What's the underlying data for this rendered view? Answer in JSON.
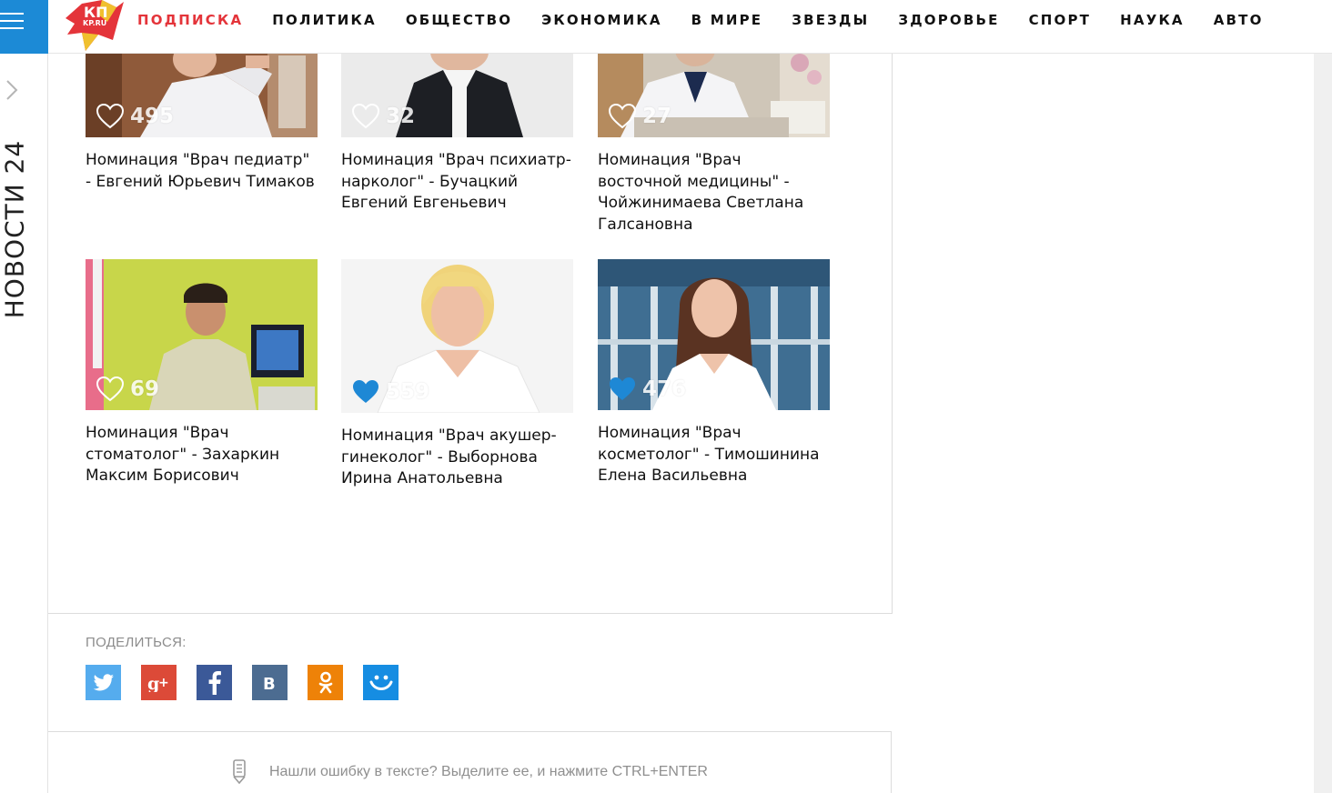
{
  "rail": {
    "title": "НОВОСТИ 24"
  },
  "logo": {
    "text_top": "КП",
    "text_bottom": "KP.RU"
  },
  "nav": {
    "items": [
      {
        "label": "ПОДПИСКА",
        "highlight": true
      },
      {
        "label": "ПОЛИТИКА"
      },
      {
        "label": "ОБЩЕСТВО"
      },
      {
        "label": "ЭКОНОМИКА"
      },
      {
        "label": "В МИРЕ"
      },
      {
        "label": "ЗВЕЗДЫ"
      },
      {
        "label": "ЗДОРОВЬЕ"
      },
      {
        "label": "СПОРТ"
      },
      {
        "label": "НАУКА"
      },
      {
        "label": "АВТО"
      }
    ]
  },
  "colors": {
    "accent_blue": "#1c8ad6",
    "nav_highlight": "#e4343a",
    "like_filled": "#1e88d5"
  },
  "nominees": [
    {
      "likes": "495",
      "liked": false,
      "caption": "Номинация \"Врач педиатр\" - Евгений Юрьевич Тимаков"
    },
    {
      "likes": "32",
      "liked": false,
      "caption": "Номинация \"Врач психиатр-нарколог\" - Бучацкий Евгений Евгеньевич"
    },
    {
      "likes": "27",
      "liked": false,
      "caption": "Номинация \"Врач восточной медицины\" - Чойжинимаева Светлана Галсановна"
    },
    {
      "likes": "69",
      "liked": false,
      "caption": "Номинация \"Врач стоматолог\" - Захаркин Максим Борисович"
    },
    {
      "likes": "559",
      "liked": true,
      "caption": "Номинация \"Врач акушер-гинеколог\" - Выборнова Ирина Анатольевна"
    },
    {
      "likes": "476",
      "liked": true,
      "caption": "Номинация \"Врач косметолог\" - Тимошинина Елена Васильевна"
    }
  ],
  "share": {
    "label": "ПОДЕЛИТЬСЯ:",
    "networks": [
      {
        "icon": "twitter-icon",
        "color": "#55acee"
      },
      {
        "icon": "google-plus-icon",
        "color": "#dc4a38"
      },
      {
        "icon": "facebook-icon",
        "color": "#3b5998"
      },
      {
        "icon": "vk-icon",
        "color": "#4c6c91"
      },
      {
        "icon": "odnoklassniki-icon",
        "color": "#ee8208"
      },
      {
        "icon": "moi-mir-icon",
        "color": "#168de2"
      }
    ]
  },
  "error_hint": {
    "text": "Нашли ошибку в тексте? Выделите ее, и нажмите CTRL+ENTER"
  }
}
